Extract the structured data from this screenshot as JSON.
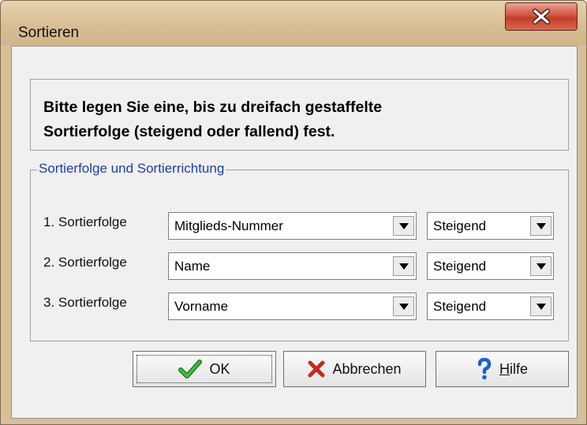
{
  "window": {
    "title": "Sortieren"
  },
  "info": {
    "line1": "Bitte legen Sie eine, bis zu dreifach gestaffelte",
    "line2": "Sortierfolge (steigend oder fallend) fest."
  },
  "group": {
    "legend": "Sortierfolge und Sortierrichtung",
    "rows": [
      {
        "label": "1. Sortierfolge",
        "field": "Mitglieds-Nummer",
        "direction": "Steigend"
      },
      {
        "label": "2. Sortierfolge",
        "field": "Name",
        "direction": "Steigend"
      },
      {
        "label": "3. Sortierfolge",
        "field": "Vorname",
        "direction": "Steigend"
      }
    ]
  },
  "buttons": {
    "ok": "OK",
    "cancel": "Abbrechen",
    "help_mnemonic": "H",
    "help_rest": "ilfe"
  },
  "icons": {
    "close": "close-x-icon",
    "ok": "green-checkmark-icon",
    "cancel": "red-x-icon",
    "help": "blue-question-mark-icon"
  },
  "colors": {
    "title_bar": "#d8bf9a",
    "close_button": "#c94a36",
    "legend_text": "#1f3ea8",
    "ok_check": "#2f9e2f",
    "cancel_x": "#c8281e",
    "help_q": "#1c5fd1"
  }
}
